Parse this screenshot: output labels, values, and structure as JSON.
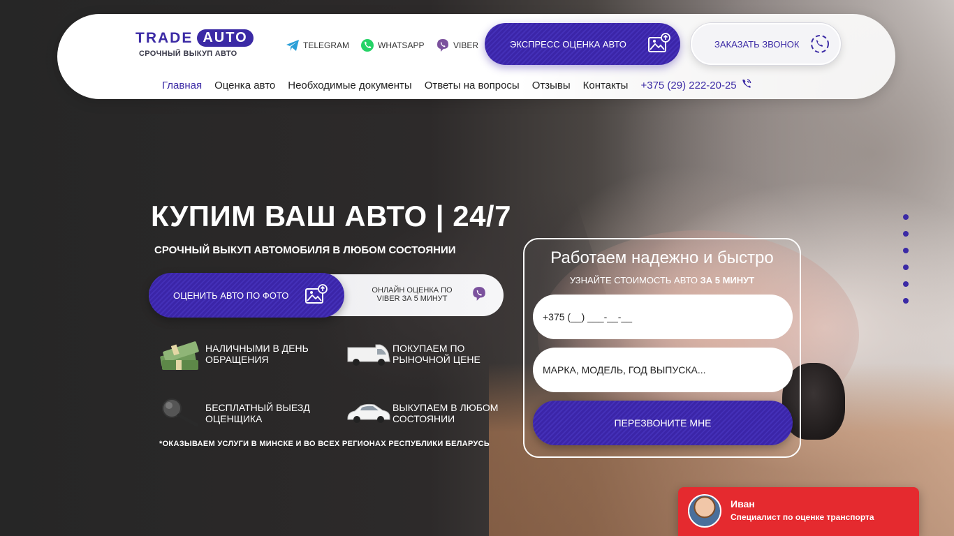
{
  "colors": {
    "brand": "#3b2aa5",
    "chat_bg": "#e52a2f",
    "white": "#ffffff"
  },
  "header": {
    "logo": {
      "trade": "TRADE",
      "auto": "AUTO",
      "tagline": "СРОЧНЫЙ ВЫКУП АВТО"
    },
    "messengers": [
      {
        "label": "TELEGRAM",
        "icon": "telegram-icon"
      },
      {
        "label": "WHATSAPP",
        "icon": "whatsapp-icon"
      },
      {
        "label": "VIBER",
        "icon": "viber-icon"
      }
    ],
    "express_button": "ЭКСПРЕСС ОЦЕНКА АВТО",
    "call_button": "ЗАКАЗАТЬ ЗВОНОК",
    "nav": [
      "Главная",
      "Оценка авто",
      "Необходимые документы",
      "Ответы на вопросы",
      "Отзывы",
      "Контакты"
    ],
    "phone": "+375 (29) 222-20-25"
  },
  "hero": {
    "title": "КУПИМ ВАШ АВТО | 24/7",
    "subtitle": "СРОЧНЫЙ ВЫКУП АВТОМОБИЛЯ В ЛЮБОМ СОСТОЯНИИ",
    "cta_photo": "ОЦЕНИТЬ АВТО ПО ФОТО",
    "cta_viber": "ОНЛАЙН ОЦЕНКА ПО VIBER ЗА 5 МИНУТ",
    "features": [
      {
        "text": "НАЛИЧНЫМИ В ДЕНЬ\nОБРАЩЕНИЯ",
        "icon": "cash-icon"
      },
      {
        "text": "ПОКУПАЕМ ПО\nРЫНОЧНОЙ ЦЕНЕ",
        "icon": "van-icon"
      },
      {
        "text": "БЕСПЛАТНЫЙ ВЫЕЗД\nОЦЕНЩИКА",
        "icon": "magnifier-icon"
      },
      {
        "text": "ВЫКУПАЕМ В ЛЮБОМ\nСОСТОЯНИИ",
        "icon": "car-icon"
      }
    ],
    "note": "*ОКАЗЫВАЕМ УСЛУГИ В МИНСКЕ И ВО ВСЕХ РЕГИОНАХ РЕСПУБЛИКИ БЕЛАРУСЬ"
  },
  "form": {
    "title": "Работаем надежно и быстро",
    "subtitle_prefix": "УЗНАЙТЕ СТОИМОСТЬ АВТО ",
    "subtitle_bold": "ЗА 5 МИНУТ",
    "phone_value": "+375 (__) ___-__-__",
    "car_placeholder": "МАРКА, МОДЕЛЬ, ГОД ВЫПУСКА...",
    "submit": "ПЕРЕЗВОНИТЕ МНЕ"
  },
  "chat": {
    "name": "Иван",
    "role": "Специалист по оценке транспорта"
  }
}
